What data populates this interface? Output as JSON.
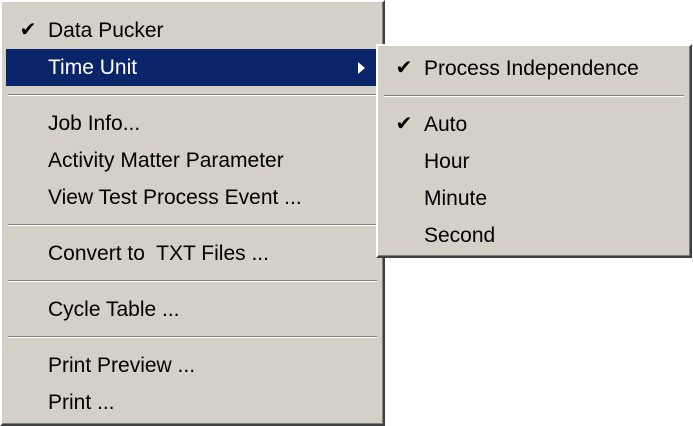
{
  "main_menu": {
    "items": [
      {
        "label": "Data Pucker",
        "checked": true
      },
      {
        "label": "Time Unit",
        "submenu": true,
        "highlighted": true
      },
      {
        "label": "Job Info..."
      },
      {
        "label": "Activity Matter Parameter"
      },
      {
        "label": "View Test Process Event ..."
      },
      {
        "label": "Convert to  TXT Files ..."
      },
      {
        "label": "Cycle Table ..."
      },
      {
        "label": "Print Preview ..."
      },
      {
        "label": "Print ..."
      }
    ]
  },
  "sub_menu": {
    "items": [
      {
        "label": "Process Independence",
        "checked": true
      },
      {
        "label": "Auto",
        "checked": true
      },
      {
        "label": "Hour"
      },
      {
        "label": "Minute"
      },
      {
        "label": "Second"
      }
    ]
  },
  "icons": {
    "check": "check-icon",
    "submenu_arrow": "chevron-right-icon"
  },
  "colors": {
    "menu_bg": "#d4d0c8",
    "highlight_bg": "#0a246a",
    "highlight_text": "#ffffff"
  }
}
